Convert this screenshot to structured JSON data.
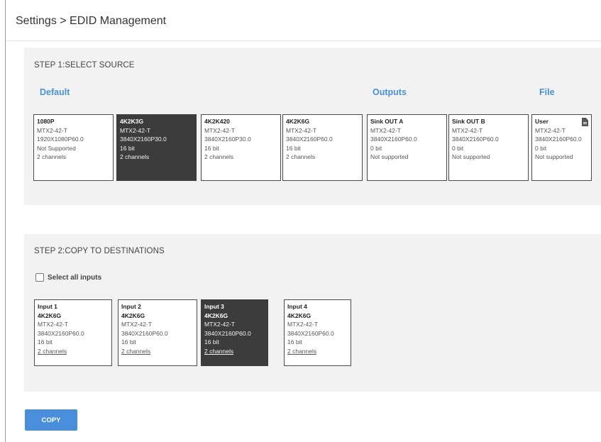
{
  "header": {
    "breadcrumb": "Settings > EDID Management"
  },
  "step1": {
    "title": "STEP 1:SELECT SOURCE",
    "groups": {
      "default": "Default",
      "outputs": "Outputs",
      "file": "File"
    },
    "sources": [
      {
        "name": "1080P",
        "device": "MTX2-42-T",
        "resolution": "1920X1080P60.0",
        "depth": "Not Supported",
        "audio": "2 channels",
        "selected": false
      },
      {
        "name": "4K2K3G",
        "device": "MTX2-42-T",
        "resolution": "3840X2160P30.0",
        "depth": "16 bit",
        "audio": "2 channels",
        "selected": true
      },
      {
        "name": "4K2K420",
        "device": "MTX2-42-T",
        "resolution": "3840X2160P30.0",
        "depth": "16 bit",
        "audio": "2 channels",
        "selected": false
      },
      {
        "name": "4K2K6G",
        "device": "MTX2-42-T",
        "resolution": "3840X2160P60.0",
        "depth": "16 bit",
        "audio": "2 channels",
        "selected": false
      },
      {
        "name": "Sink OUT A",
        "device": "MTX2-42-T",
        "resolution": "3840X2160P60.0",
        "depth": "0 bit",
        "audio": "Not supported",
        "selected": false
      },
      {
        "name": "Sink OUT B",
        "device": "MTX2-42-T",
        "resolution": "3840X2160P60.0",
        "depth": "0 bit",
        "audio": "Not supported",
        "selected": false
      },
      {
        "name": "User",
        "device": "MTX2-42-T",
        "resolution": "3840X2160P60.0",
        "depth": "0 bit",
        "audio": "Not supported",
        "selected": false,
        "icon": "file-icon"
      }
    ]
  },
  "step2": {
    "title": "STEP 2:COPY TO DESTINATIONS",
    "select_all_label": "Select all inputs",
    "select_all_checked": false,
    "destinations": [
      {
        "name": "Input 1",
        "edid": "4K2K6G",
        "device": "MTX2-42-T",
        "resolution": "3840X2160P60.0",
        "depth": "16 bit",
        "audio": "2 channels",
        "selected": false
      },
      {
        "name": "Input 2",
        "edid": "4K2K6G",
        "device": "MTX2-42-T",
        "resolution": "3840X2160P60.0",
        "depth": "16 bit",
        "audio": "2 channels",
        "selected": false
      },
      {
        "name": "Input 3",
        "edid": "4K2K6G",
        "device": "MTX2-42-T",
        "resolution": "3840X2160P60.0",
        "depth": "16 bit",
        "audio": "2 channels",
        "selected": true
      },
      {
        "name": "Input 4",
        "edid": "4K2K6G",
        "device": "MTX2-42-T",
        "resolution": "3840X2160P60.0",
        "depth": "16 bit",
        "audio": "2 channels",
        "selected": false
      }
    ]
  },
  "actions": {
    "copy_label": "COPY"
  },
  "colors": {
    "accent": "#4a8fdc",
    "selected_card": "#3c3c3c",
    "panel_bg": "#f2f2f2"
  }
}
